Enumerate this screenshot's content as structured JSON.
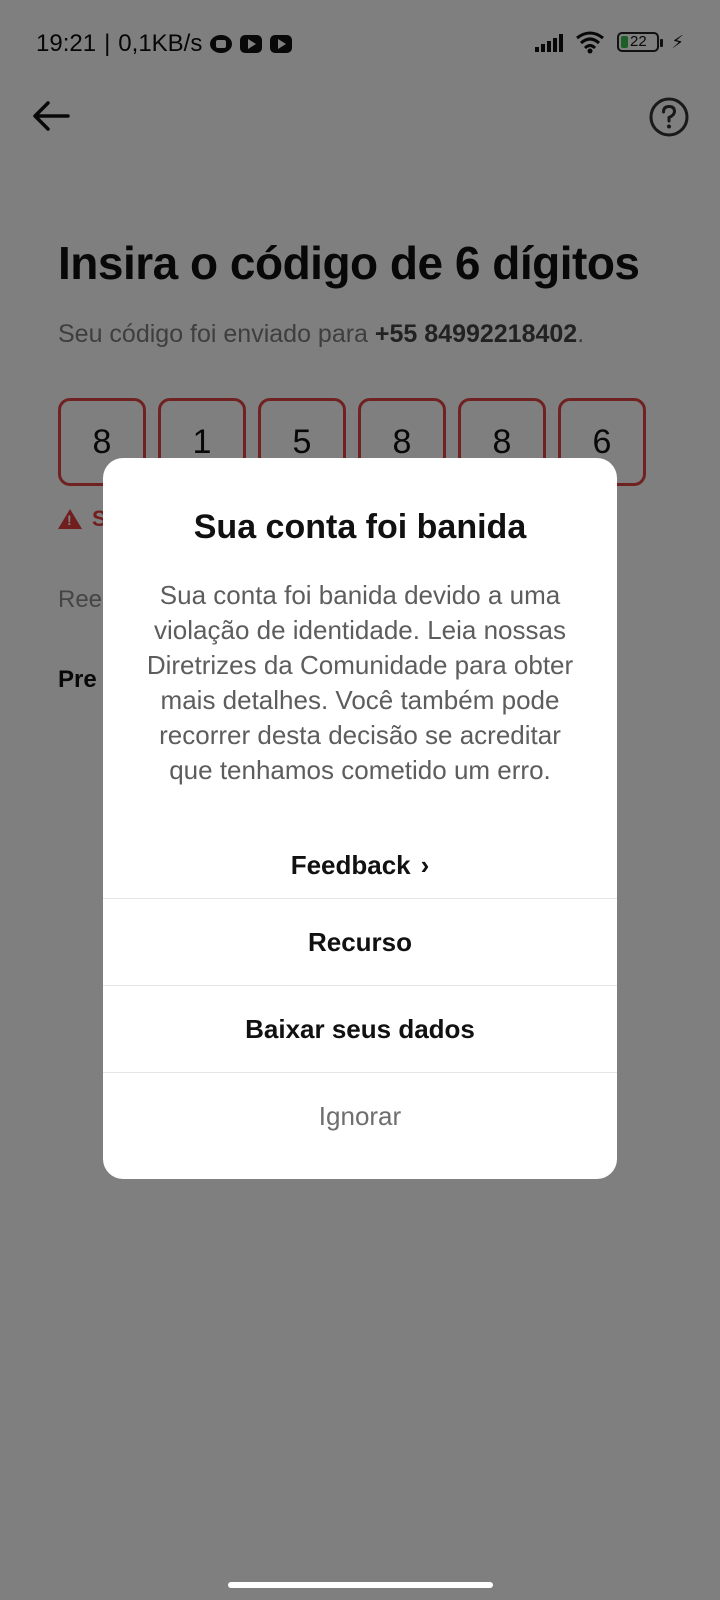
{
  "status_bar": {
    "time": "19:21",
    "separator": "|",
    "speed": "0,1KB/s",
    "battery_level": "22",
    "battery_fraction": 0.22,
    "icons": [
      "camera-app-icon",
      "youtube-icon",
      "youtube-icon",
      "signal-icon",
      "wifi-icon",
      "battery-icon",
      "charging-icon"
    ]
  },
  "header": {
    "back_icon": "back-arrow-icon",
    "help_icon": "help-icon"
  },
  "verify": {
    "title": "Insira o código de 6 dígitos",
    "subtitle_prefix": "Seu código foi enviado para ",
    "phone": "+55 84992218402",
    "subtitle_suffix": ".",
    "digits": [
      "8",
      "1",
      "5",
      "8",
      "8",
      "6"
    ],
    "error_text": "S",
    "resend_text": "Ree",
    "password_link": "Pre",
    "error_color": "#e04545"
  },
  "modal": {
    "title": "Sua conta foi banida",
    "body": "Sua conta foi banida devido a uma violação de identidade. Leia nossas Diretrizes da Comunidade para obter mais detalhes. Você também pode recorrer desta decisão se acreditar que tenhamos cometido um erro.",
    "feedback_label": "Feedback",
    "feedback_icon": "chevron-right-icon",
    "buttons": {
      "appeal": "Recurso",
      "download": "Baixar seus dados",
      "ignore": "Ignorar"
    }
  }
}
